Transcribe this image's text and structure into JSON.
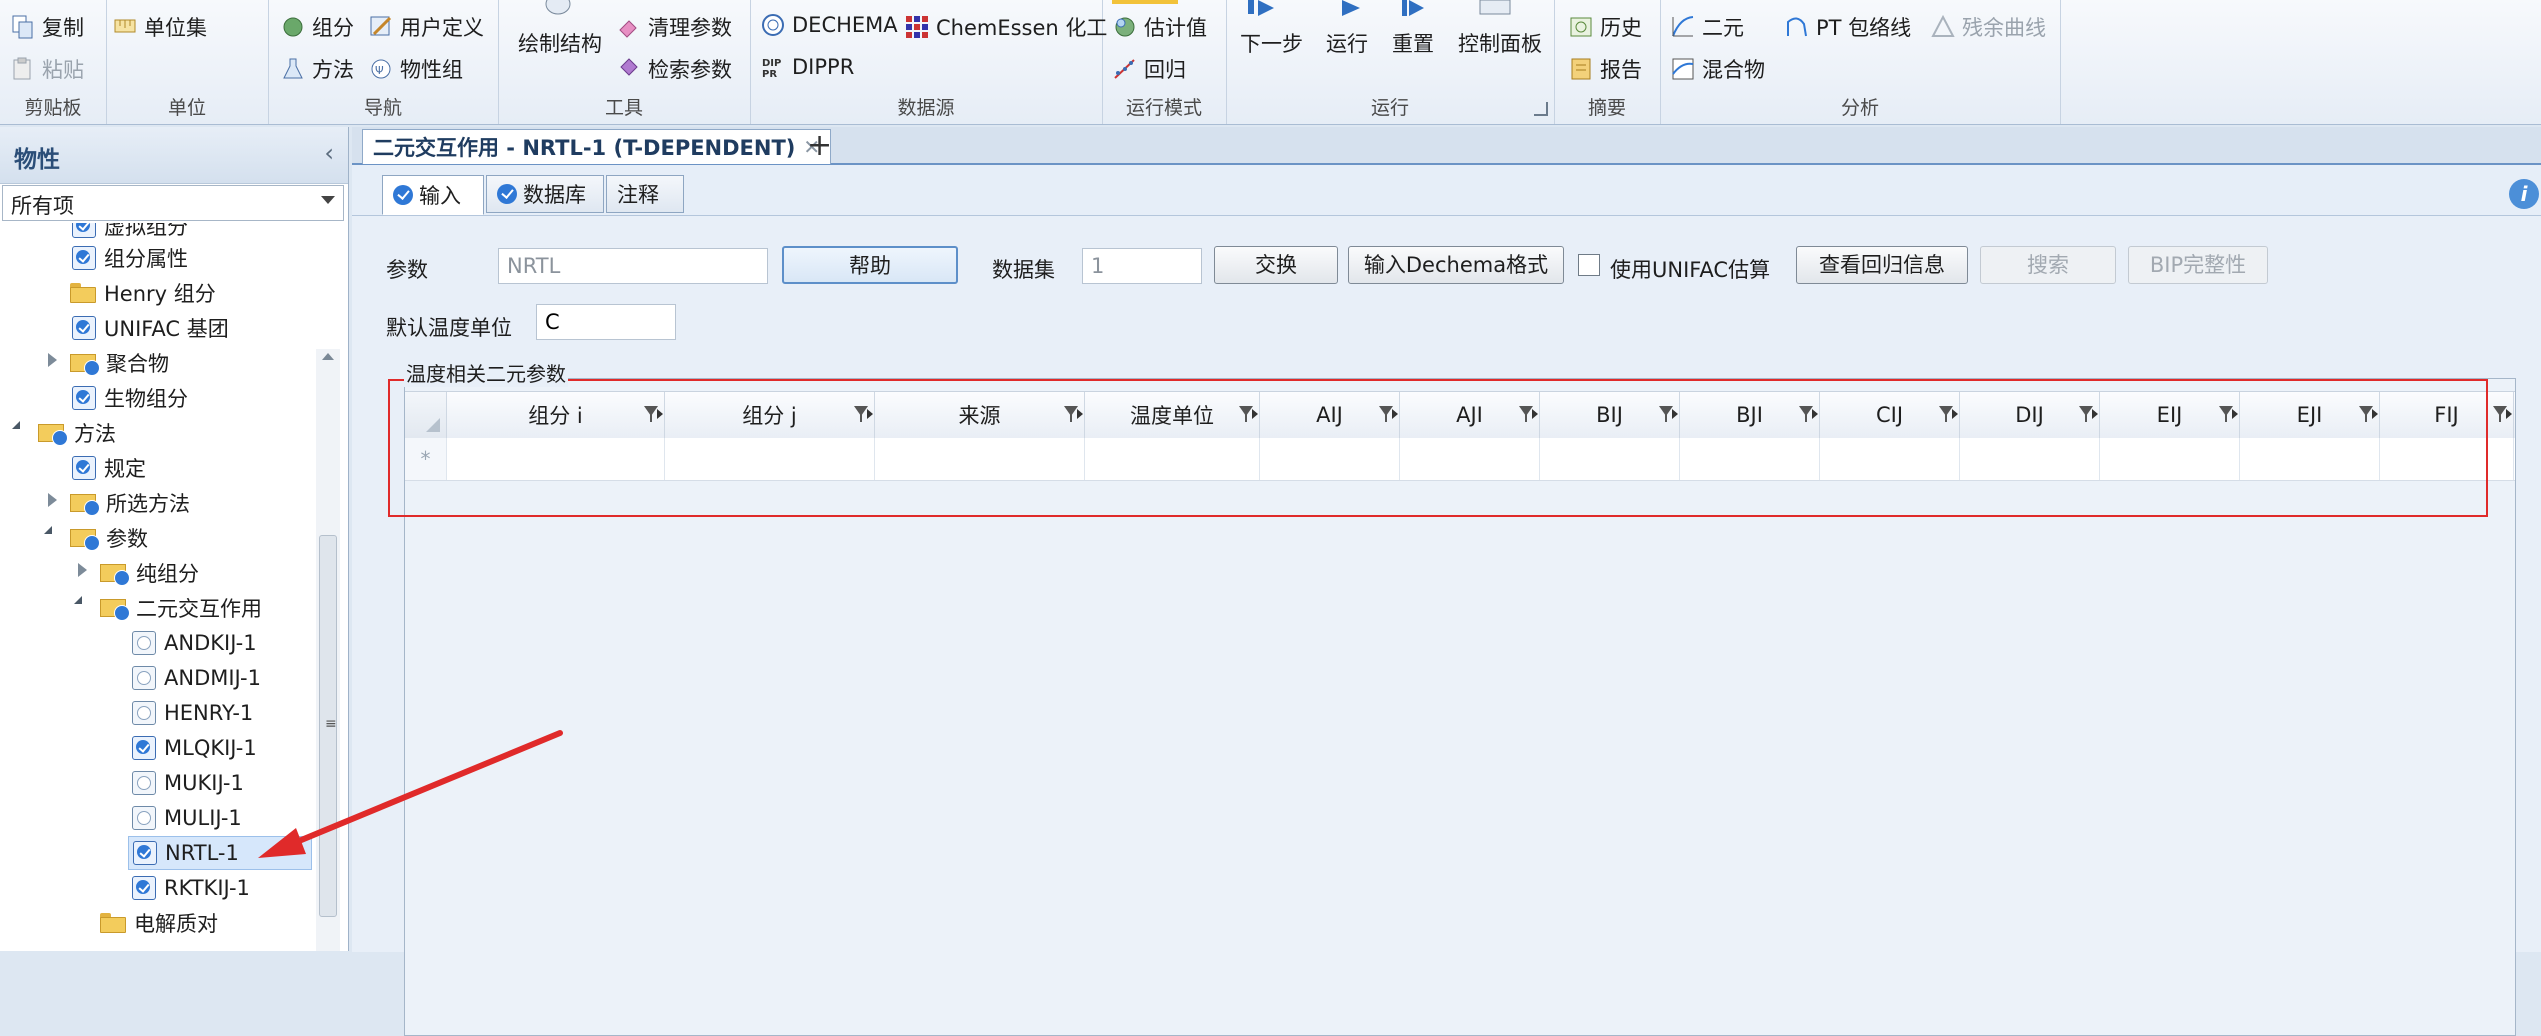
{
  "ribbon": {
    "clipboard": {
      "label": "剪贴板",
      "copy": "复制",
      "paste": "粘贴"
    },
    "units": {
      "label": "单位",
      "unit_sets": "单位集"
    },
    "navigate": {
      "label": "导航",
      "components": "组分",
      "user_defined": "用户定义",
      "methods": "方法",
      "property_sets": "物性组"
    },
    "tools": {
      "label": "工具",
      "draw_structure": "绘制结构",
      "clean_params": "清理参数",
      "check_params": "检索参数"
    },
    "data_source": {
      "label": "数据源",
      "dechema": "DECHEMA",
      "chemessen": "ChemEssen 化工",
      "dippr": "DIPPR"
    },
    "run_mode": {
      "label": "运行模式",
      "estimate": "估计值",
      "regression": "回归"
    },
    "run": {
      "label": "运行",
      "next": "下一步",
      "run": "运行",
      "reset": "重置",
      "control_panel": "控制面板"
    },
    "summary": {
      "label": "摘要",
      "history": "历史",
      "report": "报告"
    },
    "analysis": {
      "label": "分析",
      "binary": "二元",
      "mixture": "混合物",
      "pt_envelope": "PT 包络线",
      "residue_curve": "残余曲线"
    }
  },
  "left_panel": {
    "title": "物性",
    "filter_value": "所有项",
    "tree": [
      {
        "label": "虚拟组分",
        "icon": "check"
      },
      {
        "label": "组分属性",
        "icon": "check"
      },
      {
        "label": "Henry 组分",
        "icon": "folder"
      },
      {
        "label": "UNIFAC 基团",
        "icon": "check"
      },
      {
        "label": "聚合物",
        "icon": "folder-check"
      },
      {
        "label": "生物组分",
        "icon": "check"
      },
      {
        "label": "方法",
        "icon": "folder-check"
      },
      {
        "label": "规定",
        "icon": "check"
      },
      {
        "label": "所选方法",
        "icon": "folder-check"
      },
      {
        "label": "参数",
        "icon": "folder-check"
      },
      {
        "label": "纯组分",
        "icon": "folder-check"
      },
      {
        "label": "二元交互作用",
        "icon": "folder-check"
      },
      {
        "label": "ANDKIJ-1",
        "icon": "blank"
      },
      {
        "label": "ANDMIJ-1",
        "icon": "blank"
      },
      {
        "label": "HENRY-1",
        "icon": "blank"
      },
      {
        "label": "MLQKIJ-1",
        "icon": "check"
      },
      {
        "label": "MUKIJ-1",
        "icon": "blank"
      },
      {
        "label": "MULIJ-1",
        "icon": "blank"
      },
      {
        "label": "NRTL-1",
        "icon": "check"
      },
      {
        "label": "RKTKIJ-1",
        "icon": "check"
      },
      {
        "label": "电解质对",
        "icon": "folder"
      }
    ]
  },
  "document": {
    "tab_title": "二元交互作用 - NRTL-1 (T-DEPENDENT)",
    "add_tab": "+",
    "subtabs": {
      "input": "输入",
      "databank": "数据库",
      "comments": "注释"
    },
    "info": "i",
    "form": {
      "param_label": "参数",
      "param_value": "NRTL",
      "help_button": "帮助",
      "dataset_label": "数据集",
      "dataset_value": "1",
      "swap_button": "交换",
      "dechema_button": "输入Dechema格式",
      "unifac_label": "使用UNIFAC估算",
      "regression_info_button": "查看回归信息",
      "search_button": "搜索",
      "bip_button": "BIP完整性",
      "temp_unit_label": "默认温度单位",
      "temp_unit_value": "C"
    },
    "grid": {
      "title": "温度相关二元参数",
      "columns": [
        "组分 i",
        "组分 j",
        "来源",
        "温度单位",
        "AIJ",
        "AJI",
        "BIJ",
        "BJI",
        "CIJ",
        "DIJ",
        "EIJ",
        "EJI",
        "FIJ"
      ],
      "new_row_marker": "*"
    }
  },
  "colors": {
    "highlight_box": "#e02a2a",
    "accent": "#2f78d6"
  }
}
